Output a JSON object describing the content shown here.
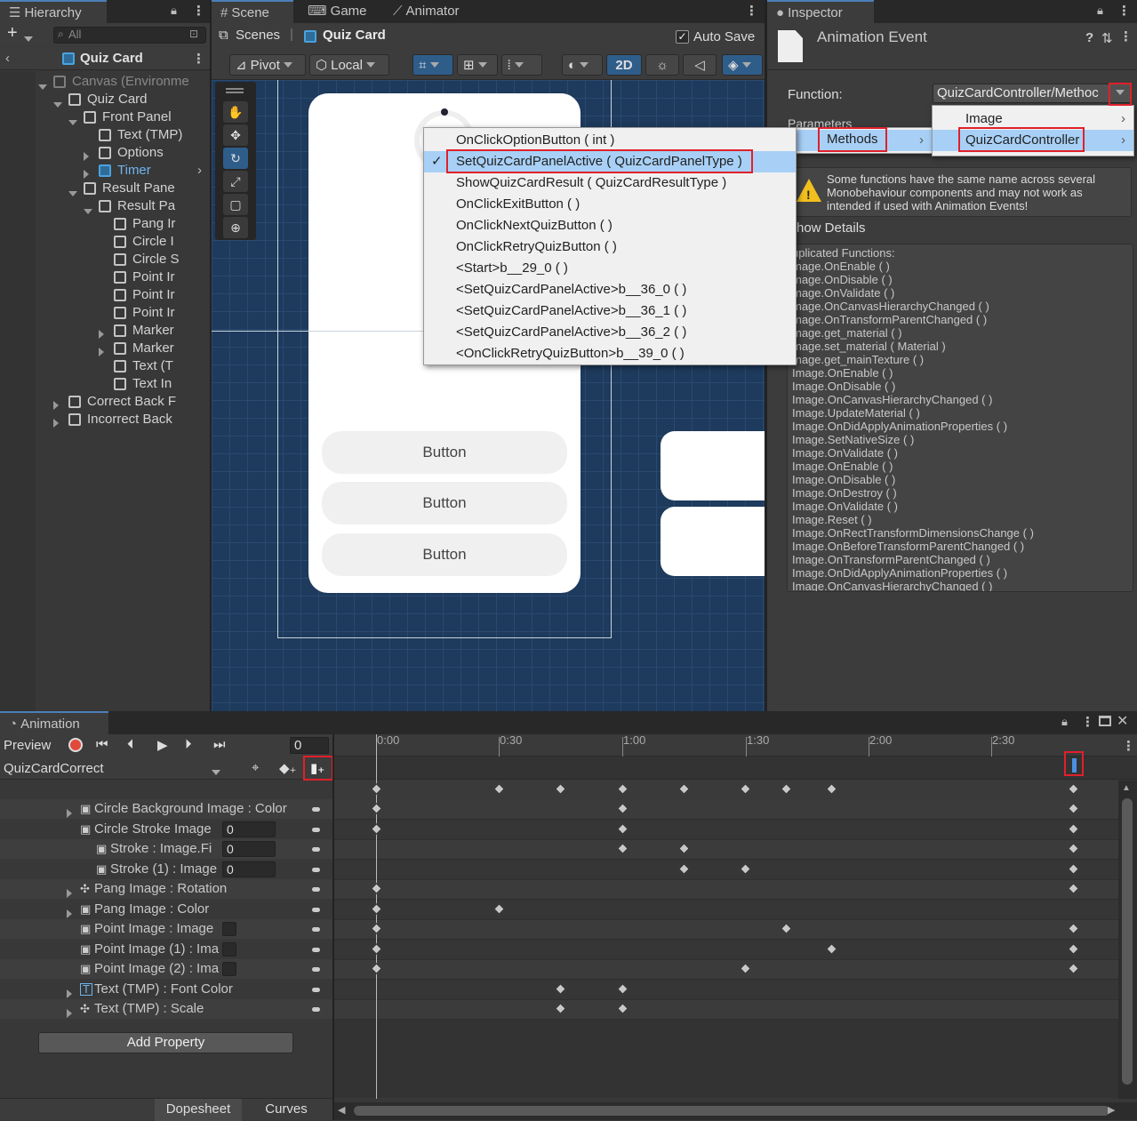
{
  "hierarchy": {
    "tab": "Hierarchy",
    "search_placeholder": "All",
    "scene": "Quiz Card",
    "items": [
      {
        "label": "Canvas (Environme",
        "indent": 0,
        "arrow": "down",
        "dim": true
      },
      {
        "label": "Quiz Card",
        "indent": 1,
        "arrow": "down"
      },
      {
        "label": "Front Panel",
        "indent": 2,
        "arrow": "down"
      },
      {
        "label": "Text (TMP)",
        "indent": 3,
        "arrow": ""
      },
      {
        "label": "Options",
        "indent": 3,
        "arrow": "right"
      },
      {
        "label": "Timer",
        "indent": 3,
        "arrow": "right",
        "blue": true
      },
      {
        "label": "Result Pane",
        "indent": 2,
        "arrow": "down"
      },
      {
        "label": "Result Pa",
        "indent": 3,
        "arrow": "down"
      },
      {
        "label": "Pang Ir",
        "indent": 4,
        "arrow": ""
      },
      {
        "label": "Circle I",
        "indent": 4,
        "arrow": ""
      },
      {
        "label": "Circle S",
        "indent": 4,
        "arrow": ""
      },
      {
        "label": "Point Ir",
        "indent": 4,
        "arrow": ""
      },
      {
        "label": "Point Ir",
        "indent": 4,
        "arrow": ""
      },
      {
        "label": "Point Ir",
        "indent": 4,
        "arrow": ""
      },
      {
        "label": "Marker",
        "indent": 4,
        "arrow": "right"
      },
      {
        "label": "Marker",
        "indent": 4,
        "arrow": "right"
      },
      {
        "label": "Text (T",
        "indent": 4,
        "arrow": ""
      },
      {
        "label": "Text In",
        "indent": 4,
        "arrow": ""
      },
      {
        "label": "Correct Back F",
        "indent": 1,
        "arrow": "right"
      },
      {
        "label": "Incorrect Back",
        "indent": 1,
        "arrow": "right"
      }
    ]
  },
  "scene": {
    "tabs": [
      "Scene",
      "Game",
      "Animator"
    ],
    "breadcrumb_root": "Scenes",
    "breadcrumb_current": "Quiz Card",
    "auto_save": "Auto Save",
    "pivot": "Pivot",
    "local": "Local",
    "mode_2d": "2D",
    "buttons": [
      "Button",
      "Button",
      "Button"
    ]
  },
  "method_menu": {
    "items": [
      {
        "label": "OnClickOptionButton ( int )",
        "selected": false
      },
      {
        "label": "SetQuizCardPanelActive ( QuizCardPanelType )",
        "selected": true
      },
      {
        "label": "ShowQuizCardResult ( QuizCardResultType )",
        "selected": false
      },
      {
        "label": "OnClickExitButton ( )",
        "selected": false
      },
      {
        "label": "OnClickNextQuizButton ( )",
        "selected": false
      },
      {
        "label": "OnClickRetryQuizButton ( )",
        "selected": false
      },
      {
        "label": "<Start>b__29_0 ( )",
        "selected": false
      },
      {
        "label": "<SetQuizCardPanelActive>b__36_0 ( )",
        "selected": false
      },
      {
        "label": "<SetQuizCardPanelActive>b__36_1 ( )",
        "selected": false
      },
      {
        "label": "<SetQuizCardPanelActive>b__36_2 ( )",
        "selected": false
      },
      {
        "label": "<OnClickRetryQuizButton>b__39_0 ( )",
        "selected": false
      }
    ],
    "submenu_methods": "Methods",
    "submenu_image": "Image",
    "submenu_controller": "QuizCardController"
  },
  "inspector": {
    "tab": "Inspector",
    "title": "Animation Event",
    "function_label": "Function:",
    "function_value": "QuizCardController/Methoc",
    "parameters_label": "Parameters",
    "warning": "Some functions have the same name across several Monobehaviour components and may not work as intended if used with Animation Events!",
    "show_details": "how Details",
    "dup_title": "uplicated Functions:",
    "dups": [
      "mage.OnEnable ( )",
      "mage.OnDisable ( )",
      "mage.OnValidate ( )",
      "mage.OnCanvasHierarchyChanged ( )",
      "mage.OnTransformParentChanged ( )",
      "mage.get_material ( )",
      "mage.set_material ( Material )",
      "mage.get_mainTexture ( )",
      "Image.OnEnable ( )",
      "Image.OnDisable ( )",
      "Image.OnCanvasHierarchyChanged ( )",
      "Image.UpdateMaterial ( )",
      "Image.OnDidApplyAnimationProperties ( )",
      "Image.SetNativeSize ( )",
      "Image.OnValidate ( )",
      "Image.OnEnable ( )",
      "Image.OnDisable ( )",
      "Image.OnDestroy ( )",
      "Image.OnValidate ( )",
      "Image.Reset ( )",
      "Image.OnRectTransformDimensionsChange ( )",
      "Image.OnBeforeTransformParentChanged ( )",
      "Image.OnTransformParentChanged ( )",
      "Image.OnDidApplyAnimationProperties ( )",
      "Image.OnCanvasHierarchyChanged ( )"
    ]
  },
  "animation": {
    "tab": "Animation",
    "preview": "Preview",
    "frame": "0",
    "clip": "QuizCardCorrect",
    "add_property": "Add Property",
    "dopesheet": "Dopesheet",
    "curves": "Curves",
    "ticks": [
      "0:00",
      "0:30",
      "1:00",
      "1:30",
      "2:00",
      "2:30"
    ],
    "properties": [
      {
        "label": "Circle Background Image : Color",
        "arrow": true,
        "icon": "image-icon",
        "field": ""
      },
      {
        "label": "Circle Stroke Image",
        "arrow": false,
        "icon": "image-icon",
        "field": "0"
      },
      {
        "label": "Stroke : Image.Fi",
        "arrow": false,
        "icon": "image-icon",
        "field": "0",
        "sub": true
      },
      {
        "label": "Stroke (1) : Image",
        "arrow": false,
        "icon": "image-icon",
        "field": "0",
        "sub": true
      },
      {
        "label": "Pang Image : Rotation",
        "arrow": true,
        "icon": "rotate-icon",
        "field": ""
      },
      {
        "label": "Pang Image : Color",
        "arrow": true,
        "icon": "image-icon",
        "field": ""
      },
      {
        "label": "Point Image : Image",
        "arrow": false,
        "icon": "image-icon",
        "field": "check"
      },
      {
        "label": "Point Image (1) : Ima",
        "arrow": false,
        "icon": "image-icon",
        "field": "check"
      },
      {
        "label": "Point Image (2) : Ima",
        "arrow": false,
        "icon": "image-icon",
        "field": "check"
      },
      {
        "label": "Text (TMP) : Font Color",
        "arrow": true,
        "icon": "tmp-icon",
        "field": ""
      },
      {
        "label": "Text (TMP) : Scale",
        "arrow": true,
        "icon": "scale-icon",
        "field": ""
      }
    ]
  }
}
